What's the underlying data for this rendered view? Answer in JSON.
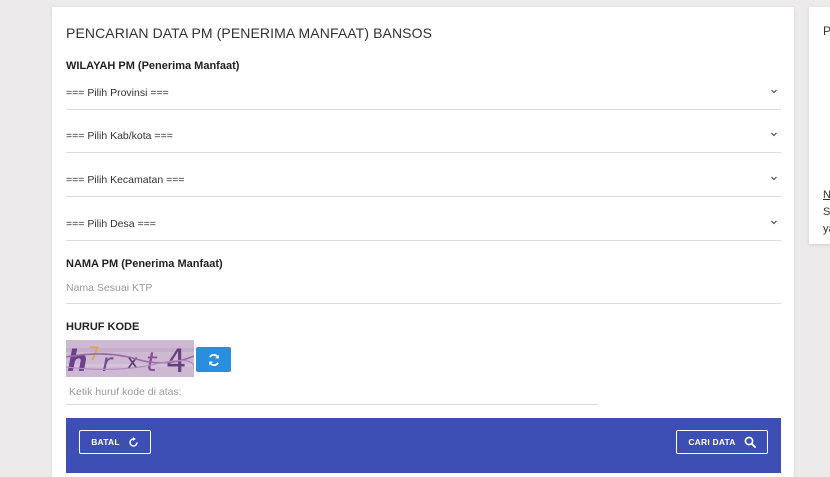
{
  "form": {
    "title": "PENCARIAN DATA PM (PENERIMA MANFAAT) BANSOS",
    "region_label": "WILAYAH PM (Penerima Manfaat)",
    "selects": [
      {
        "value": "=== Pilih Provinsi ==="
      },
      {
        "value": "=== Pilih Kab/kota ==="
      },
      {
        "value": "=== Pilih Kecamatan ==="
      },
      {
        "value": "=== Pilih Desa ==="
      }
    ],
    "name_label": "NAMA PM (Penerima Manfaat)",
    "name_placeholder": "Nama Sesuai KTP",
    "code_label": "HURUF KODE",
    "captcha_text": "h7rxt4",
    "code_placeholder": "Ketik huruf kode di atas:",
    "cancel_label": "BATAL",
    "search_label": "CARI DATA"
  },
  "side_panel": {
    "title_fragment": "P",
    "link_fragment": "N",
    "line1_fragment": "Sl",
    "line2_fragment": "ya"
  },
  "icons": {
    "select_arrow": "chevron-down-icon",
    "refresh": "refresh-icon",
    "cancel": "refresh-icon",
    "search": "search-icon"
  },
  "colors": {
    "footer_bar": "#3d4fb4",
    "refresh_button": "#2a8ee0",
    "page_background": "#eceaea"
  }
}
